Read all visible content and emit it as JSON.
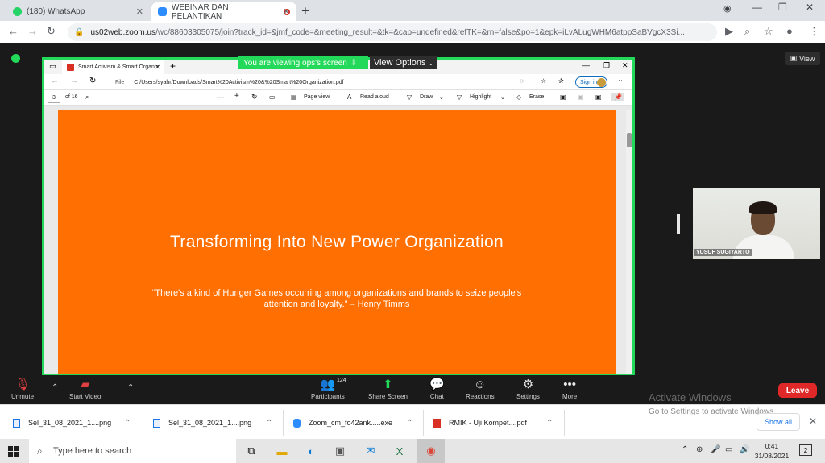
{
  "chrome": {
    "tabs": [
      {
        "label": "(180) WhatsApp",
        "icon": "whatsapp-icon"
      },
      {
        "label": "WEBINAR DAN PELANTIKAN",
        "icon": "zoom-icon"
      }
    ],
    "url_host": "us02web.zoom.us",
    "url_path": "/wc/88603305075/join?track_id=&jmf_code=&meeting_result=&tk=&cap=undefined&refTK=&rn=false&po=1&epk=iLvALugWHM6atppSaBVgcX3Si..."
  },
  "zoom": {
    "share_banner": "You are viewing ops's screen",
    "view_options": "View Options",
    "view_button": "View",
    "participant_name": "YUSUF SUGIYARTO",
    "participants_count": "124",
    "toolbar": {
      "unmute": "Unmute",
      "start_video": "Start Video",
      "participants": "Participants",
      "share_screen": "Share Screen",
      "chat": "Chat",
      "reactions": "Reactions",
      "settings": "Settings",
      "more": "More",
      "leave": "Leave"
    }
  },
  "edge": {
    "tab_label": "Smart Activism & Smart Organiz...",
    "file_label": "File",
    "url": "C:/Users/syahr/Downloads/Smart%20Activism%20&%20Smart%20Organization.pdf",
    "sign_in": "Sign in",
    "page": "3",
    "page_total": "of 16",
    "tools": [
      "Page view",
      "Read aloud",
      "Draw",
      "Highlight",
      "Erase"
    ]
  },
  "slide": {
    "title": "Transforming Into New Power Organization",
    "quote": "“There's a kind of Hunger Games occurring among organizations and brands to seize people's attention and loyalty.” – Henry Timms",
    "background": "#ff6f02"
  },
  "downloads": [
    {
      "name": "Sel_31_08_2021_1....png"
    },
    {
      "name": "Sel_31_08_2021_1....png"
    },
    {
      "name": "Zoom_cm_fo42ank.....exe"
    },
    {
      "name": "RMIK - Uji Kompet....pdf"
    }
  ],
  "show_all": "Show all",
  "activate": {
    "line1": "Activate Windows",
    "line2": "Go to Settings to activate Windows."
  },
  "taskbar": {
    "search_placeholder": "Type here to search",
    "time": "0:41",
    "date": "31/08/2021",
    "notifications": "2"
  }
}
